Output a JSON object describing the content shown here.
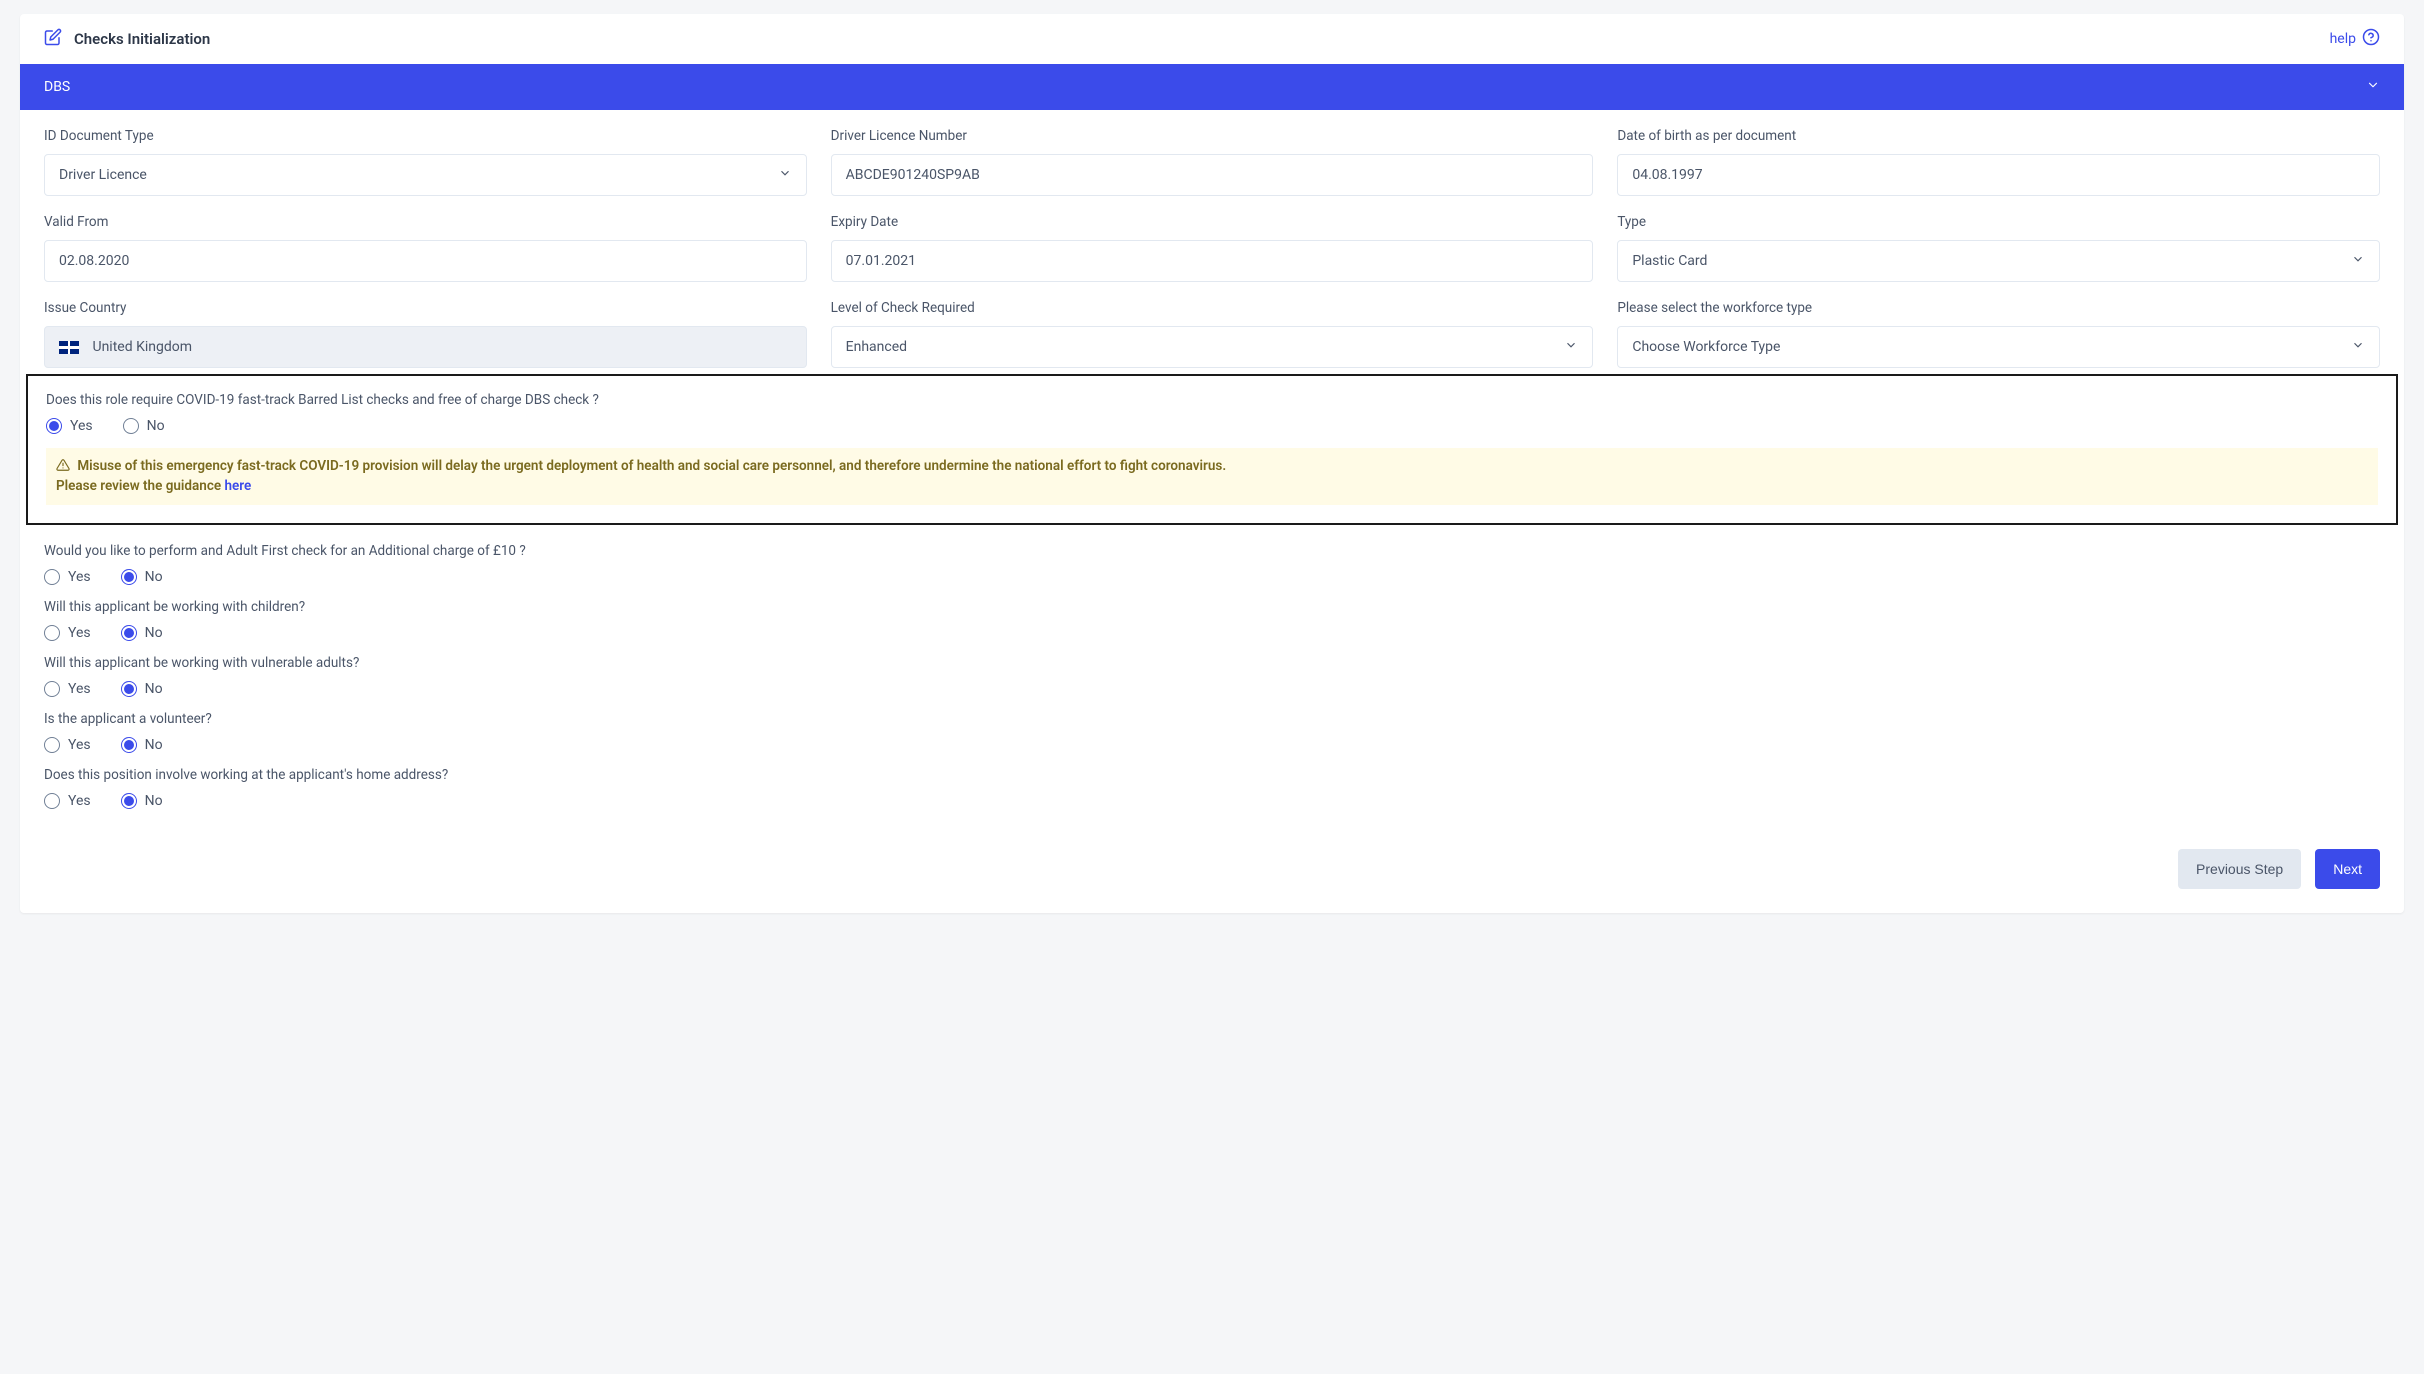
{
  "header": {
    "title": "Checks Initialization",
    "help_label": "help"
  },
  "accordion": {
    "title": "DBS"
  },
  "fields": {
    "id_doc_type": {
      "label": "ID Document Type",
      "value": "Driver Licence"
    },
    "licence_number": {
      "label": "Driver Licence Number",
      "value": "ABCDE901240SP9AB"
    },
    "dob": {
      "label": "Date of birth as per document",
      "value": "04.08.1997"
    },
    "valid_from": {
      "label": "Valid From",
      "value": "02.08.2020"
    },
    "expiry": {
      "label": "Expiry Date",
      "value": "07.01.2021"
    },
    "type": {
      "label": "Type",
      "value": "Plastic Card"
    },
    "issue_country": {
      "label": "Issue Country",
      "value": "United Kingdom"
    },
    "level_check": {
      "label": "Level of Check Required",
      "value": "Enhanced"
    },
    "workforce": {
      "label": "Please select the workforce type",
      "value": "Choose Workforce Type"
    }
  },
  "questions": {
    "covid": {
      "label": "Does this role require COVID-19 fast-track Barred List checks and free of charge DBS check ?",
      "yes": "Yes",
      "no": "No",
      "selected": "yes"
    },
    "adult_first": {
      "label": "Would you like to perform and Adult First check for an Additional charge of £10 ?",
      "yes": "Yes",
      "no": "No",
      "selected": "no"
    },
    "children": {
      "label": "Will this applicant be working with children?",
      "yes": "Yes",
      "no": "No",
      "selected": "no"
    },
    "vuln_adults": {
      "label": "Will this applicant be working with vulnerable adults?",
      "yes": "Yes",
      "no": "No",
      "selected": "no"
    },
    "volunteer": {
      "label": "Is the applicant a volunteer?",
      "yes": "Yes",
      "no": "No",
      "selected": "no"
    },
    "home_address": {
      "label": "Does this position involve working at the applicant's home address?",
      "yes": "Yes",
      "no": "No",
      "selected": "no"
    }
  },
  "warning": {
    "line1": "Misuse of this emergency fast-track COVID-19 provision will delay the urgent deployment of health and social care personnel, and therefore undermine the national effort to fight coronavirus.",
    "line2_prefix": "Please review the guidance ",
    "link": "here"
  },
  "footer": {
    "prev": "Previous Step",
    "next": "Next"
  }
}
